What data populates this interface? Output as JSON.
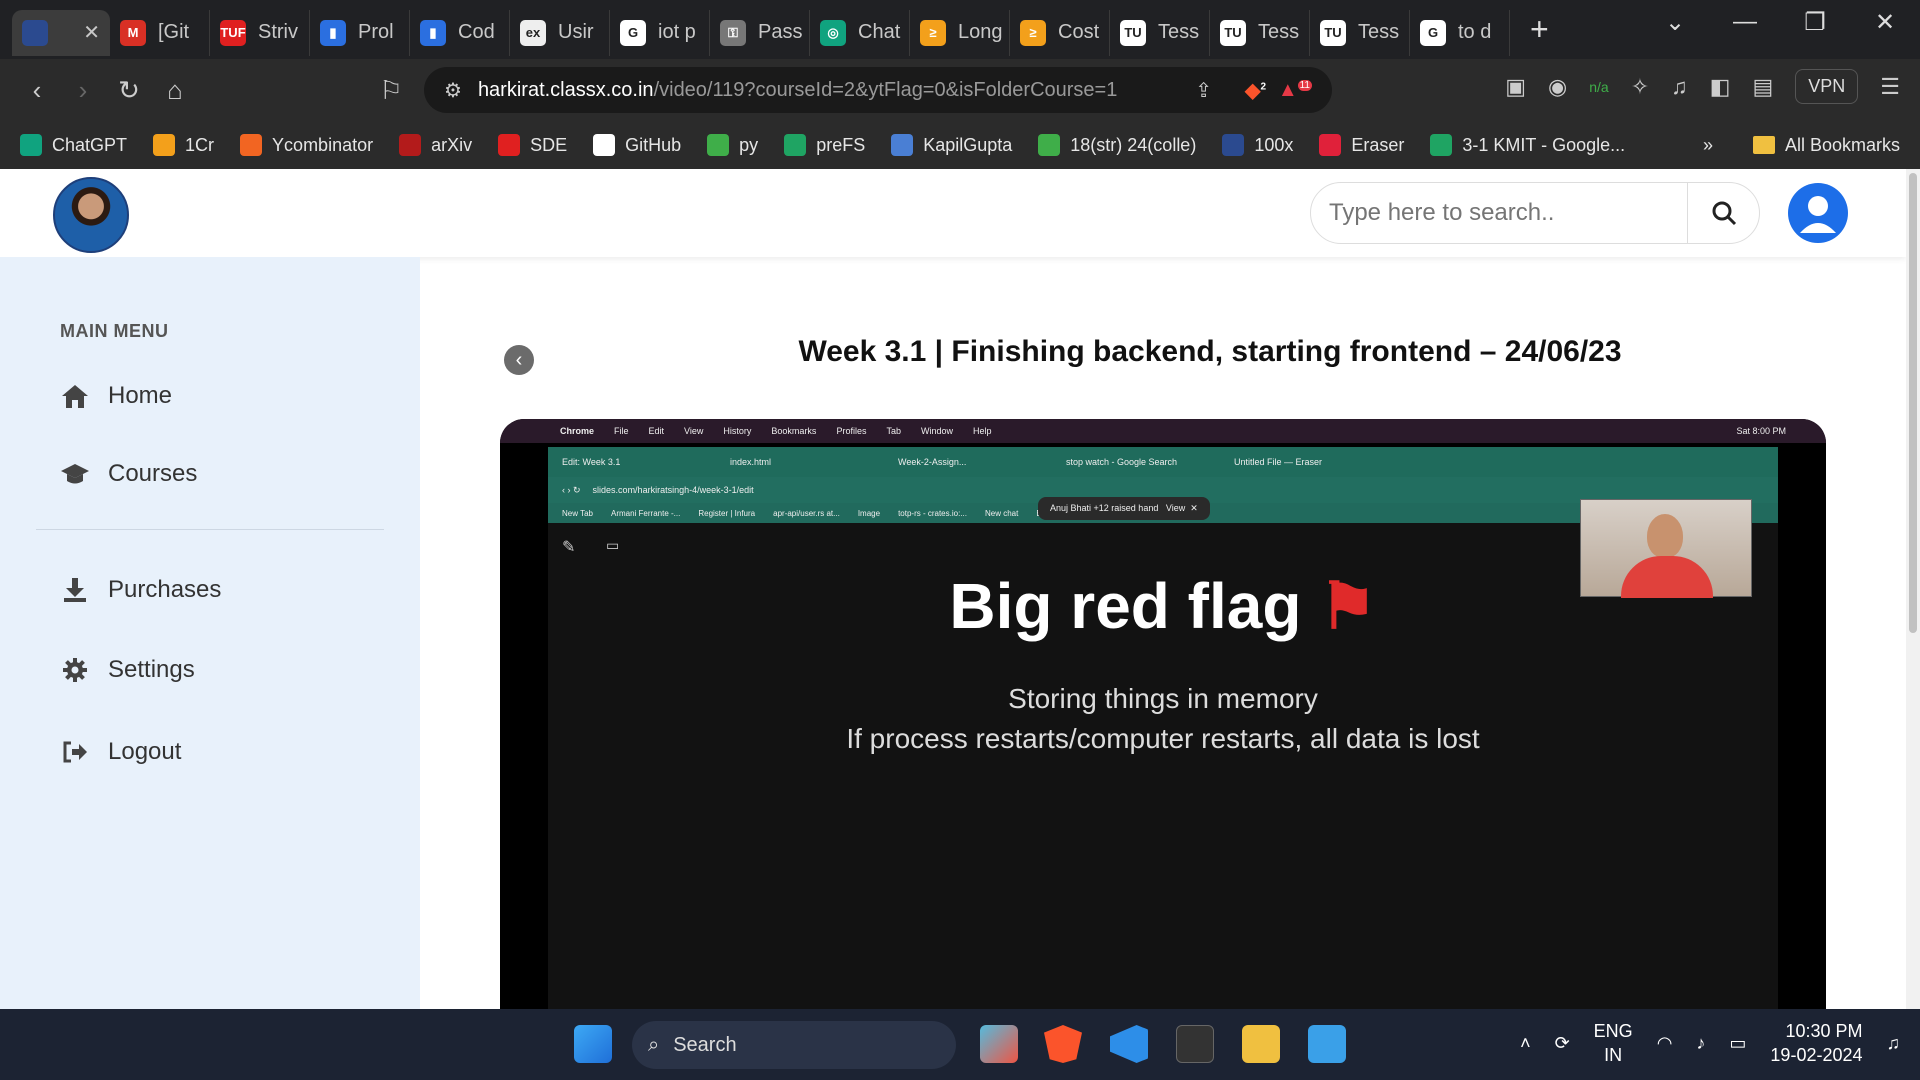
{
  "browser": {
    "tabs": [
      {
        "label": "",
        "color": "#2b4a8f",
        "glyph": ""
      },
      {
        "label": "[Git",
        "color": "#d93025",
        "glyph": "M"
      },
      {
        "label": "Striv",
        "color": "#e02020",
        "glyph": "TUF"
      },
      {
        "label": "Prol",
        "color": "#2b6fe0",
        "glyph": "▮"
      },
      {
        "label": "Cod",
        "color": "#2b6fe0",
        "glyph": "▮"
      },
      {
        "label": "Usir",
        "color": "#eeeeee",
        "glyph": "ex"
      },
      {
        "label": "iot p",
        "color": "#ffffff",
        "glyph": "G"
      },
      {
        "label": "Pass",
        "color": "#777777",
        "glyph": "⚿"
      },
      {
        "label": "Chat",
        "color": "#10a37f",
        "glyph": "◎"
      },
      {
        "label": "Long",
        "color": "#f3a01b",
        "glyph": "≥"
      },
      {
        "label": "Cost",
        "color": "#f3a01b",
        "glyph": "≥"
      },
      {
        "label": "Tess",
        "color": "#ffffff",
        "glyph": "TU"
      },
      {
        "label": "Tess",
        "color": "#ffffff",
        "glyph": "TU"
      },
      {
        "label": "Tess",
        "color": "#ffffff",
        "glyph": "TU"
      },
      {
        "label": "to d",
        "color": "#ffffff",
        "glyph": "G"
      }
    ],
    "url_host": "harkirat.classx.co.in",
    "url_path": "/video/119?courseId=2&ytFlag=0&isFolderCourse=1",
    "vpn_label": "VPN",
    "brave_badge": "2",
    "rewards_badge": "11",
    "ext_badge": "n/a",
    "bookmarks": [
      {
        "label": "ChatGPT",
        "color": "#10a37f"
      },
      {
        "label": "1Cr",
        "color": "#f3a01b"
      },
      {
        "label": "Ycombinator",
        "color": "#f26522"
      },
      {
        "label": "arXiv",
        "color": "#b31b1b"
      },
      {
        "label": "SDE",
        "color": "#e02020"
      },
      {
        "label": "GitHub",
        "color": "#ffffff"
      },
      {
        "label": "py",
        "color": "#3fae49"
      },
      {
        "label": "preFS",
        "color": "#1fa463"
      },
      {
        "label": "KapilGupta",
        "color": "#4a7fd4"
      },
      {
        "label": "18(str) 24(colle)",
        "color": "#3fae49"
      },
      {
        "label": "100x",
        "color": "#2b4a8f"
      },
      {
        "label": "Eraser",
        "color": "#e0213a"
      },
      {
        "label": "3-1 KMIT - Google...",
        "color": "#1fa463"
      }
    ],
    "more_bookmarks": "»",
    "all_bookmarks": "All Bookmarks"
  },
  "site": {
    "search_placeholder": "Type here to search..",
    "main_menu_heading": "MAIN MENU",
    "menu": {
      "home": "Home",
      "courses": "Courses",
      "purchases": "Purchases",
      "settings": "Settings",
      "logout": "Logout"
    },
    "video_title": "Week 3.1 | Finishing backend, starting frontend – 24/06/23"
  },
  "video": {
    "mac_menu": [
      "Chrome",
      "File",
      "Edit",
      "View",
      "History",
      "Bookmarks",
      "Profiles",
      "Tab",
      "Window",
      "Help"
    ],
    "mac_time": "Sat 8:00 PM",
    "inner_tabs": [
      "Edit: Week 3.1",
      "index.html",
      "Week-2-Assign...",
      "stop watch - Google Search",
      "Untitled File — Eraser"
    ],
    "inner_url": "slides.com/harkiratsingh-4/week-3-1/edit",
    "inner_bookmarks": [
      "New Tab",
      "Armani Ferrante -...",
      "Register | Infura",
      "apr-api/user.rs at...",
      "Image",
      "totp-rs - crates.io:...",
      "New chat",
      "Editing \"Launchin..."
    ],
    "raised_hand": "Anuj Bhati +12 raised hand",
    "raised_view": "View",
    "slide_title": "Big red flag",
    "slide_line1": "Storing things in memory",
    "slide_line2": "If process restarts/computer restarts, all data is lost"
  },
  "taskbar": {
    "search_label": "Search",
    "lang_line1": "ENG",
    "lang_line2": "IN",
    "time": "10:30 PM",
    "date": "19-02-2024"
  }
}
